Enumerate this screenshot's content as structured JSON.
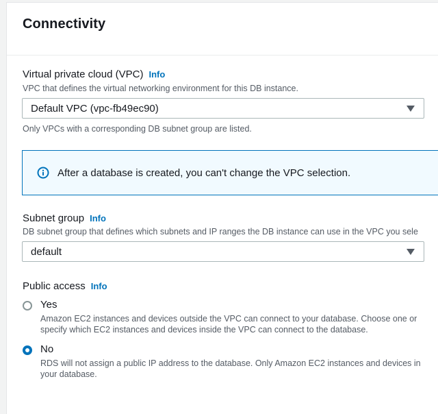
{
  "section": {
    "title": "Connectivity"
  },
  "info_label": "Info",
  "vpc": {
    "label": "Virtual private cloud (VPC)",
    "description": "VPC that defines the virtual networking environment for this DB instance.",
    "selected": "Default VPC (vpc-fb49ec90)",
    "hint": "Only VPCs with a corresponding DB subnet group are listed."
  },
  "alert": {
    "text": "After a database is created, you can't change the VPC selection."
  },
  "subnet_group": {
    "label": "Subnet group",
    "description": "DB subnet group that defines which subnets and IP ranges the DB instance can use in the VPC you sele",
    "selected": "default"
  },
  "public_access": {
    "label": "Public access",
    "selected": "No",
    "options": [
      {
        "label": "Yes",
        "description_line1": "Amazon EC2 instances and devices outside the VPC can connect to your database. Choose one or",
        "description_line2": "specify which EC2 instances and devices inside the VPC can connect to the database."
      },
      {
        "label": "No",
        "description_line1": "RDS will not assign a public IP address to the database. Only Amazon EC2 instances and devices in",
        "description_line2": "your database."
      }
    ]
  },
  "colors": {
    "accent": "#0073bb",
    "alert_background": "#f1faff",
    "text": "#16191f",
    "secondary_text": "#545b64"
  }
}
